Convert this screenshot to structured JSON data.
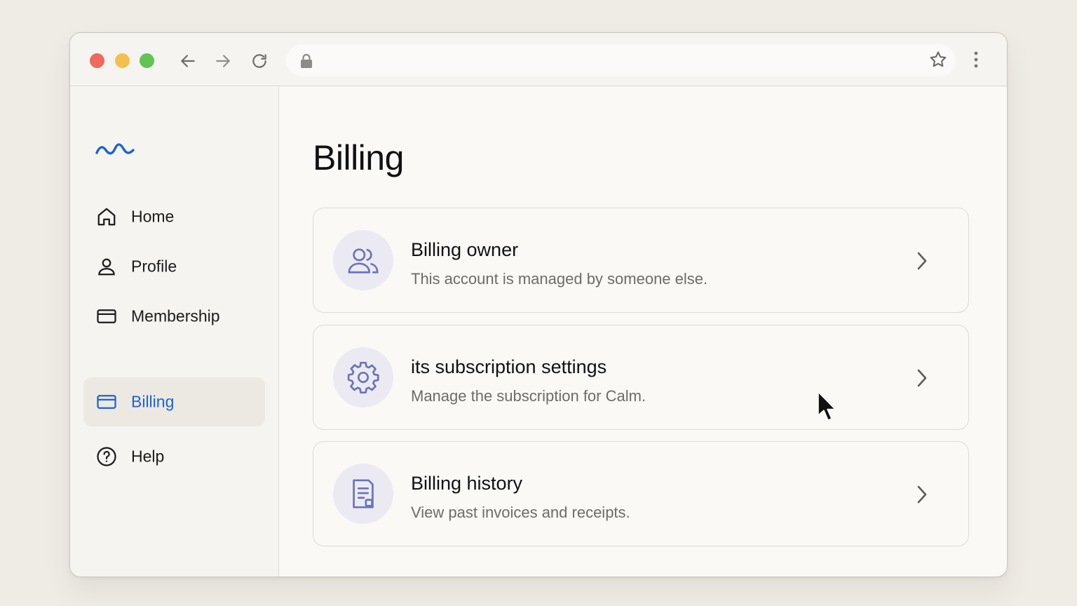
{
  "sidebar": {
    "logo": "wave-logo",
    "items": [
      {
        "label": "Home",
        "icon": "home-icon",
        "active": false
      },
      {
        "label": "Profile",
        "icon": "user-icon",
        "active": false
      },
      {
        "label": "Membership",
        "icon": "card-icon",
        "active": false
      },
      {
        "label": "Billing",
        "icon": "card-icon",
        "active": true
      },
      {
        "label": "Help",
        "icon": "help-circle-icon",
        "active": false
      }
    ]
  },
  "main": {
    "title": "Billing",
    "cards": [
      {
        "title": "Billing owner",
        "subtitle": "This account is managed by someone else.",
        "icon": "users-icon"
      },
      {
        "title": "its subscription settings",
        "subtitle": "Manage the subscription for Calm.",
        "icon": "gear-icon"
      },
      {
        "title": "Billing history",
        "subtitle": "View past invoices and receipts.",
        "icon": "document-icon"
      }
    ]
  },
  "colors": {
    "accent": "#1b63d6",
    "icon_tint": "#6a74b8",
    "icon_bg": "#ebeaf3"
  }
}
